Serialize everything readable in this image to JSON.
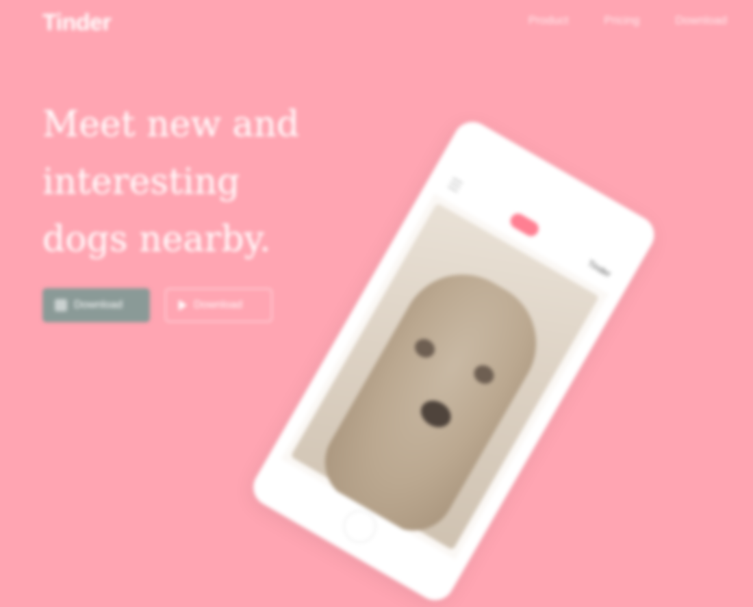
{
  "header": {
    "brand": "Tinder",
    "nav": [
      "Product",
      "Pricing",
      "Download"
    ]
  },
  "hero": {
    "headline": "Meet new and interesting dogs nearby.",
    "primary_button": "Download",
    "secondary_button": "Download"
  },
  "phone": {
    "app_title": "Tinder"
  },
  "colors": {
    "background": "#ffa5b2",
    "primary_button": "#8a9a97",
    "accent": "#ff7f92"
  }
}
